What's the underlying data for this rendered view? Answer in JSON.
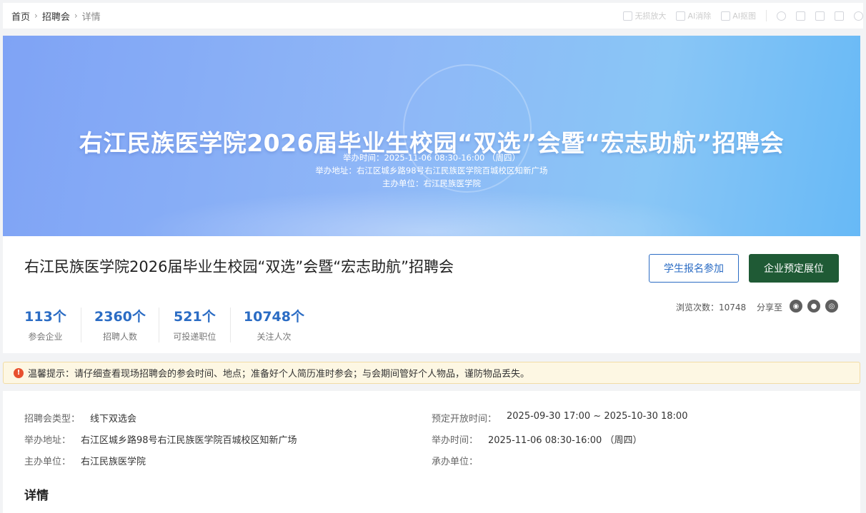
{
  "breadcrumb": [
    "首页",
    "招聘会",
    "详情"
  ],
  "toolbar": {
    "items": [
      "无损放大",
      "AI消除",
      "AI抠图"
    ]
  },
  "banner": {
    "title": "右江民族医学院2026届毕业生校园“双选”会暨“宏志助航”招聘会",
    "time_line": "举办时间：2025-11-06 08:30-16:00 （周四）",
    "address_line": "举办地址：右江区城乡路98号右江民族医学院百城校区知新广场",
    "host_line": "主办单位：右江民族医学院"
  },
  "summary": {
    "title": "右江民族医学院2026届毕业生校园“双选”会暨“宏志助航”招聘会",
    "stats": [
      {
        "value": "113个",
        "label": "参会企业"
      },
      {
        "value": "2360个",
        "label": "招聘人数"
      },
      {
        "value": "521个",
        "label": "可投递职位"
      },
      {
        "value": "10748个",
        "label": "关注人次"
      }
    ],
    "student_button": "学生报名参加",
    "company_button": "企业预定展位",
    "views": "浏览次数：10748",
    "share_label": "分享至",
    "share_icons": [
      "wechat-icon",
      "qq-icon",
      "weibo-icon"
    ]
  },
  "notice": {
    "icon": "!",
    "text": "温馨提示：请仔细查看现场招聘会的参会时间、地点；准备好个人简历准时参会；与会期间管好个人物品，谨防物品丢失。"
  },
  "details": {
    "type_label": "招聘会类型：",
    "type_value": "线下双选会",
    "address_label": "举办地址：",
    "address_value": "右江区城乡路98号右江民族医学院百城校区知新广场",
    "host_label": "主办单位：",
    "host_value": "右江民族医学院",
    "booking_label": "预定开放时间：",
    "booking_value": "2025-09-30 17:00 ~ 2025-10-30 18:00",
    "time_label": "举办时间：",
    "time_value": "2025-11-06 08:30-16:00 （周四）",
    "organizer_label": "承办单位：",
    "organizer_value": "",
    "section_title": "详情"
  }
}
